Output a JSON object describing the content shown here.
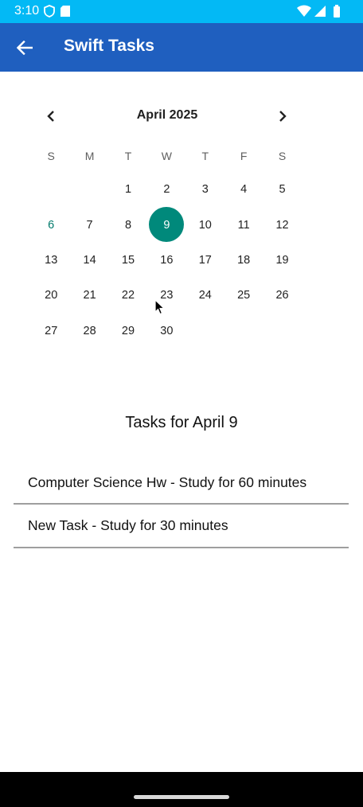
{
  "status_bar": {
    "time": "3:10",
    "icons": [
      "shield-icon",
      "sd-card-icon",
      "wifi-icon",
      "signal-icon",
      "battery-icon"
    ],
    "background": "#03b9f5"
  },
  "app_bar": {
    "title": "Swift Tasks",
    "back_icon": "arrow-left-icon",
    "background": "#1f5fbf"
  },
  "calendar": {
    "month_label": "April 2025",
    "prev_icon": "chevron-left-icon",
    "next_icon": "chevron-right-icon",
    "weekdays": [
      "S",
      "M",
      "T",
      "W",
      "T",
      "F",
      "S"
    ],
    "leading_blanks": 2,
    "days_in_month": 30,
    "today": 6,
    "selected": 9,
    "selected_color": "#00897b",
    "today_color": "#00796b"
  },
  "tasks": {
    "heading": "Tasks for April 9",
    "items": [
      "Computer Science Hw - Study for 60 minutes",
      "New Task - Study for 30 minutes"
    ]
  }
}
